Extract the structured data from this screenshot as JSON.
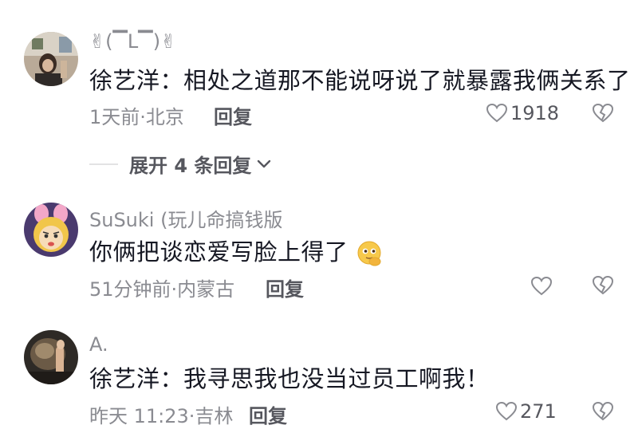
{
  "comments": [
    {
      "username": "✌(▔L▔)✌",
      "text": "徐艺洋：相处之道那不能说呀说了就暴露我俩关系了",
      "time_location": "1天前·北京",
      "reply_label": "回复",
      "like_count": "1918"
    },
    {
      "username": "SuSuki (玩儿命搞钱版",
      "text": "你俩把谈恋爱写脸上得了",
      "time_location": "51分钟前·内蒙古",
      "reply_label": "回复",
      "like_count": ""
    },
    {
      "username": "A.",
      "text": "徐艺洋：我寻思我也没当过员工啊我！",
      "time_location": "昨天 11:23·吉林",
      "reply_label": "回复",
      "like_count": "271"
    }
  ],
  "expand_replies": {
    "label": "展开 4 条回复"
  },
  "icons": {
    "like": "heart-outline-icon",
    "dislike": "broken-heart-icon",
    "expand": "chevron-down-icon",
    "emoji": "thinking-face-emoji"
  },
  "colors": {
    "text_primary": "#161823",
    "text_secondary": "#8a8b91",
    "reply_label": "#56575e"
  }
}
